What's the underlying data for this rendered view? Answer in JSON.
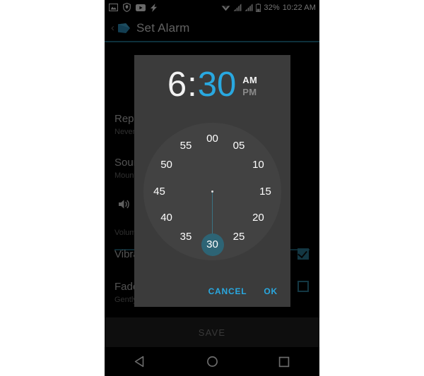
{
  "status_bar": {
    "icons": [
      "image-icon",
      "shield-icon",
      "youtube-icon",
      "flash-icon",
      "wifi-icon",
      "signal-1-icon",
      "signal-2-icon",
      "battery-icon"
    ],
    "battery_percent": "32%",
    "clock": "10:22 AM"
  },
  "app_bar": {
    "back_label": "‹",
    "app_icon": "tag-icon",
    "title": "Set Alarm"
  },
  "settings": [
    {
      "title": "Repeat",
      "subtitle": "Never"
    },
    {
      "title": "Sound",
      "subtitle": "Mountain"
    },
    {
      "title": "Volume",
      "icon": "volume-icon"
    },
    {
      "title": "Vibrate",
      "subtitle": ""
    },
    {
      "title": "Fade",
      "subtitle": "Gently"
    }
  ],
  "save_button": "SAVE",
  "nav_bar": {
    "back": "back-triangle-icon",
    "home": "home-circle-icon",
    "recents": "recents-square-icon"
  },
  "dialog": {
    "hour": "6",
    "colon": ":",
    "minute": "30",
    "am_label": "AM",
    "pm_label": "PM",
    "active_period": "AM",
    "active_field": "minute",
    "mode": "minutes",
    "selected_minute": "30",
    "dial_numbers": [
      "00",
      "05",
      "10",
      "15",
      "20",
      "25",
      "30",
      "35",
      "40",
      "45",
      "50",
      "55"
    ],
    "cancel_label": "CANCEL",
    "ok_label": "OK"
  },
  "colors": {
    "accent_blue": "#29a8e0",
    "selector_teal": "#2d6475",
    "divider_teal": "#1d6b84",
    "dialog_bg": "#3b3b3b",
    "dial_bg": "#424242",
    "screen_bg": "#000000"
  }
}
